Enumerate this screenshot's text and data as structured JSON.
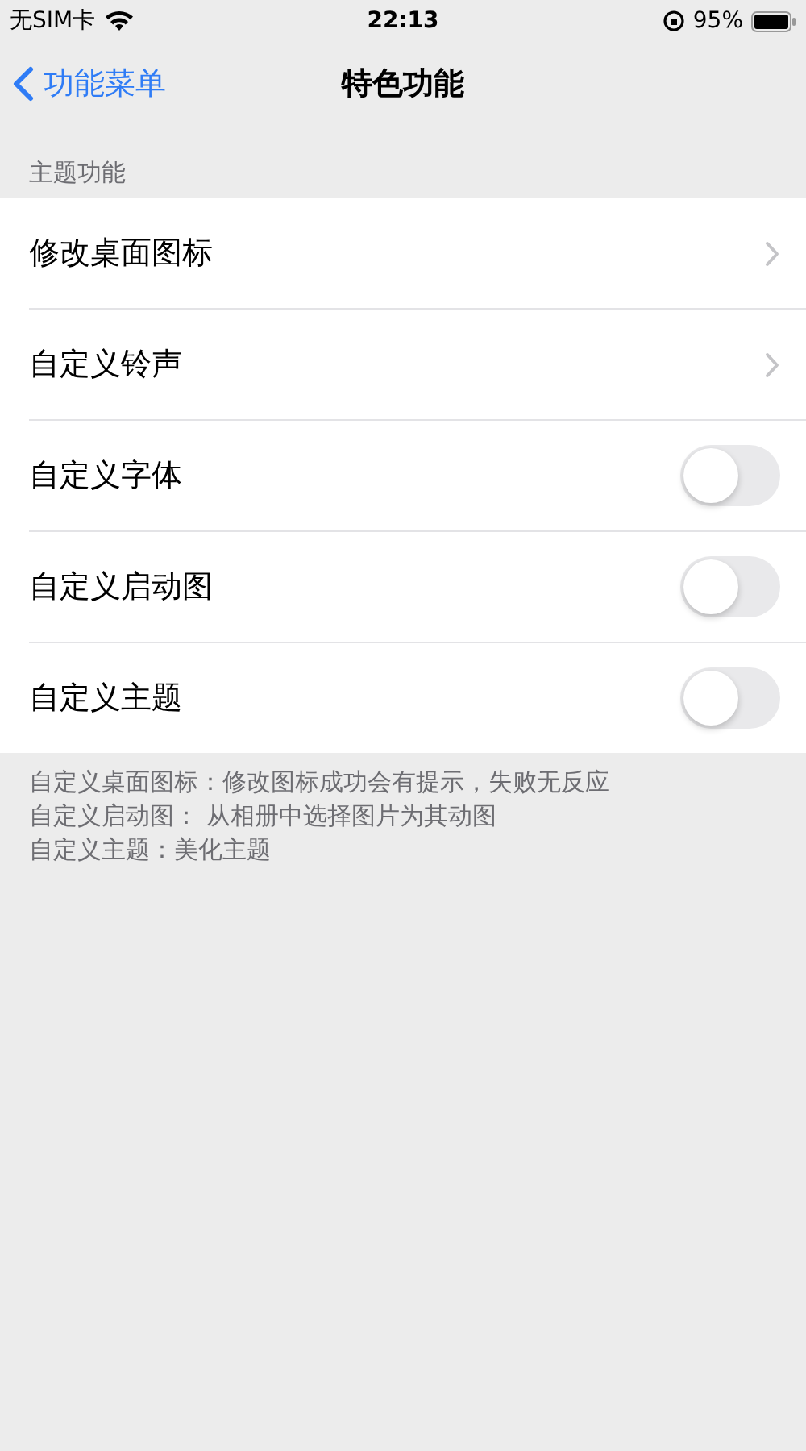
{
  "status_bar": {
    "carrier": "无SIM卡",
    "time": "22:13",
    "battery": "95%"
  },
  "nav": {
    "back": "功能菜单",
    "title": "特色功能"
  },
  "section": {
    "header": "主题功能",
    "rows": [
      {
        "kind": "link",
        "label": "修改桌面图标"
      },
      {
        "kind": "link",
        "label": "自定义铃声"
      },
      {
        "kind": "toggle",
        "label": "自定义字体",
        "on": false
      },
      {
        "kind": "toggle",
        "label": "自定义启动图",
        "on": false
      },
      {
        "kind": "toggle",
        "label": "自定义主题",
        "on": false
      }
    ],
    "footer": [
      "自定义桌面图标：修改图标成功会有提示，失败无反应",
      "自定义启动图： 从相册中选择图片为其动图",
      "自定义主题：美化主题"
    ]
  }
}
